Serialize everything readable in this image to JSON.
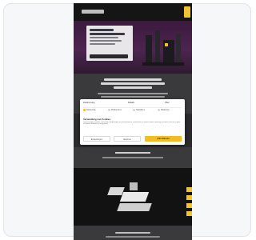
{
  "modal": {
    "tabs": [
      "Zustimmung",
      "Details",
      "Über"
    ],
    "options": [
      "Notwendig",
      "Präferenzen",
      "Statistiken",
      "Marketing"
    ],
    "heading": "Verwendung von Cookies",
    "body": "Wir verwenden Cookies, um Inhalte und Anzeigen zu personalisieren, Funktionen für soziale Medien anbieten zu können und die Zugriffe auf unsere Website zu analysieren.",
    "buttons": {
      "settings": "Einstellungen",
      "decline": "Ablehnen",
      "accept": "Alle zulassen"
    }
  },
  "colors": {
    "accent": "#f1bd22",
    "hero": "#4d2450",
    "dark": "#121212"
  },
  "icons": {
    "menu": "hamburger-menu-icon"
  }
}
